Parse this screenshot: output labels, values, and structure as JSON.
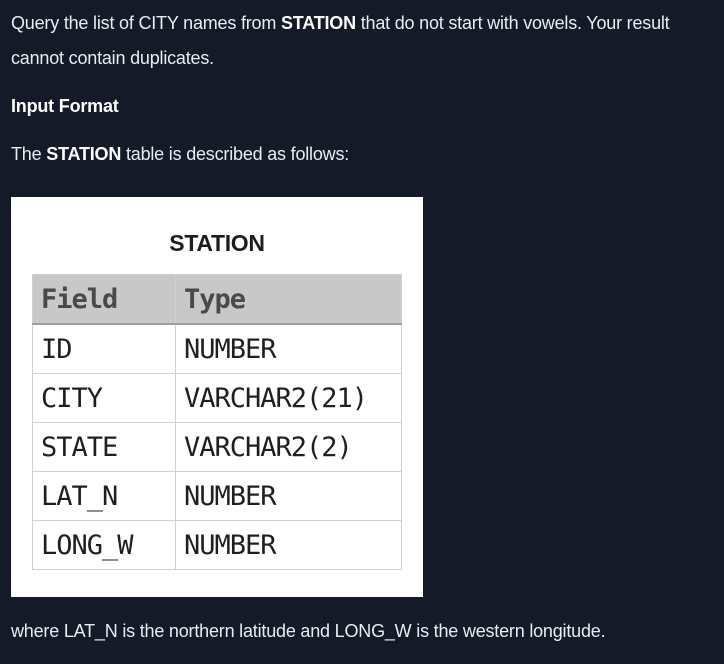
{
  "intro": {
    "part1": "Query the list of CITY names from ",
    "bold": "STATION",
    "part2": " that do not start with vowels. Your result",
    "line2": "cannot contain duplicates."
  },
  "input_format_heading": "Input Format",
  "description": {
    "part1": "The ",
    "bold": "STATION",
    "part2": " table is described as follows:"
  },
  "figure": {
    "title": "STATION",
    "headers": [
      "Field",
      "Type"
    ],
    "rows": [
      [
        "ID",
        "NUMBER"
      ],
      [
        "CITY",
        "VARCHAR2(21)"
      ],
      [
        "STATE",
        "VARCHAR2(2)"
      ],
      [
        "LAT_N",
        "NUMBER"
      ],
      [
        "LONG_W",
        "NUMBER"
      ]
    ]
  },
  "note": "where LAT_N is the northern latitude and LONG_W is the western longitude."
}
